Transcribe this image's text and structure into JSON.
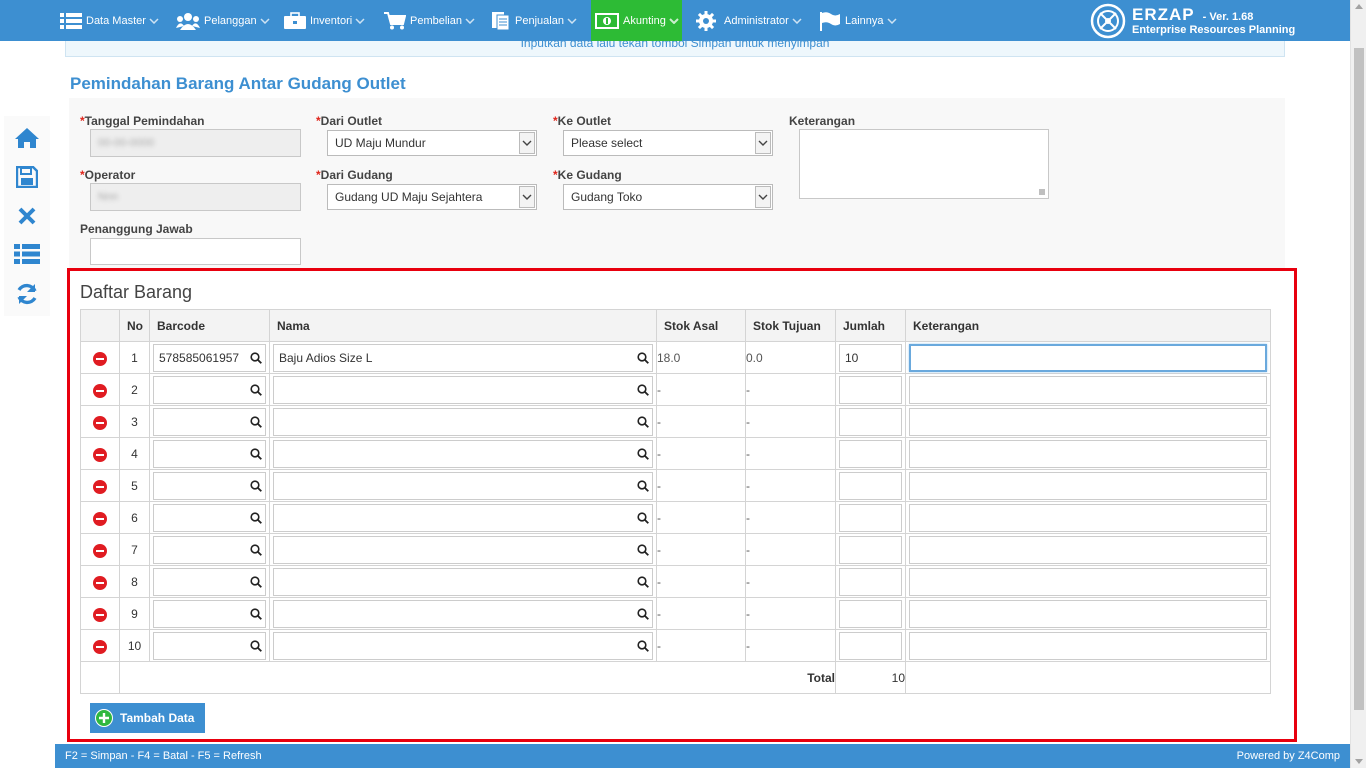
{
  "nav": {
    "items": [
      {
        "label": "Data Master",
        "icon": "list-icon"
      },
      {
        "label": "Pelanggan",
        "icon": "users-icon"
      },
      {
        "label": "Inventori",
        "icon": "briefcase-icon"
      },
      {
        "label": "Pembelian",
        "icon": "cart-icon"
      },
      {
        "label": "Penjualan",
        "icon": "document-icon"
      },
      {
        "label": "Akunting",
        "icon": "money-icon"
      },
      {
        "label": "Administrator",
        "icon": "gear-icon"
      },
      {
        "label": "Lainnya",
        "icon": "flag-icon"
      }
    ],
    "active": "Akunting"
  },
  "brand": {
    "name": "ERZAP",
    "version": "- Ver. 1.68",
    "subtitle": "Enterprise Resources Planning"
  },
  "info_strip": "Inputkan data lalu tekan tombol Simpan untuk menyimpan",
  "page_title": "Pemindahan Barang Antar Gudang Outlet",
  "form": {
    "tanggal_label": "Tanggal Pemindahan",
    "tanggal_value": "00-00-0000",
    "operator_label": "Operator",
    "operator_value": "Nnn",
    "penanggung_label": "Penanggung Jawab",
    "penanggung_value": "",
    "dari_outlet_label": "Dari Outlet",
    "dari_outlet_value": "UD Maju Mundur",
    "dari_gudang_label": "Dari Gudang",
    "dari_gudang_value": "Gudang UD Maju Sejahtera",
    "ke_outlet_label": "Ke Outlet",
    "ke_outlet_value": "Please select",
    "ke_gudang_label": "Ke Gudang",
    "ke_gudang_value": "Gudang Toko",
    "keterangan_label": "Keterangan",
    "keterangan_value": "",
    "required_mark": "*"
  },
  "daftar": {
    "title": "Daftar Barang",
    "headers": {
      "no": "No",
      "barcode": "Barcode",
      "nama": "Nama",
      "stok_asal": "Stok Asal",
      "stok_tujuan": "Stok Tujuan",
      "jumlah": "Jumlah",
      "keterangan": "Keterangan"
    },
    "rows": [
      {
        "no": "1",
        "barcode": "578585061957",
        "nama": "Baju Adios Size L",
        "stok_asal": "18.0",
        "stok_tujuan": "0.0",
        "jumlah": "10",
        "keterangan": ""
      },
      {
        "no": "2",
        "barcode": "",
        "nama": "",
        "stok_asal": "-",
        "stok_tujuan": "-",
        "jumlah": "",
        "keterangan": ""
      },
      {
        "no": "3",
        "barcode": "",
        "nama": "",
        "stok_asal": "-",
        "stok_tujuan": "-",
        "jumlah": "",
        "keterangan": ""
      },
      {
        "no": "4",
        "barcode": "",
        "nama": "",
        "stok_asal": "-",
        "stok_tujuan": "-",
        "jumlah": "",
        "keterangan": ""
      },
      {
        "no": "5",
        "barcode": "",
        "nama": "",
        "stok_asal": "-",
        "stok_tujuan": "-",
        "jumlah": "",
        "keterangan": ""
      },
      {
        "no": "6",
        "barcode": "",
        "nama": "",
        "stok_asal": "-",
        "stok_tujuan": "-",
        "jumlah": "",
        "keterangan": ""
      },
      {
        "no": "7",
        "barcode": "",
        "nama": "",
        "stok_asal": "-",
        "stok_tujuan": "-",
        "jumlah": "",
        "keterangan": ""
      },
      {
        "no": "8",
        "barcode": "",
        "nama": "",
        "stok_asal": "-",
        "stok_tujuan": "-",
        "jumlah": "",
        "keterangan": ""
      },
      {
        "no": "9",
        "barcode": "",
        "nama": "",
        "stok_asal": "-",
        "stok_tujuan": "-",
        "jumlah": "",
        "keterangan": ""
      },
      {
        "no": "10",
        "barcode": "",
        "nama": "",
        "stok_asal": "-",
        "stok_tujuan": "-",
        "jumlah": "",
        "keterangan": ""
      }
    ],
    "total_label": "Total",
    "total_value": "10",
    "add_button": "Tambah Data"
  },
  "footer": {
    "shortcuts": "F2 = Simpan - F4 = Batal - F5 = Refresh",
    "powered": "Powered by Z4Comp"
  },
  "colors": {
    "primary": "#3d8fd1",
    "active_nav": "#2dbb35",
    "highlight_border": "#e8000e",
    "delete": "#e01c22"
  }
}
